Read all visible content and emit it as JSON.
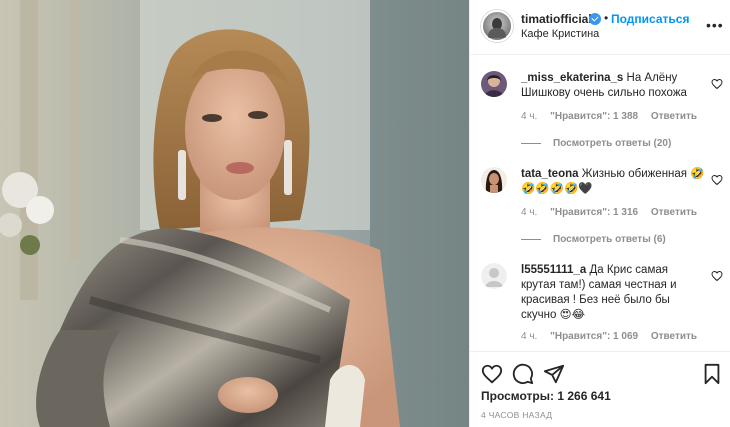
{
  "post": {
    "username": "timatiofficial",
    "follow_label": "Подписаться",
    "separator": "•",
    "location": "Кафе Кристина",
    "more_label": "•••"
  },
  "comments": [
    {
      "username": "_miss_ekaterina_s",
      "text": "На Алёну Шишкову очень сильно похожа",
      "time": "4 ч.",
      "likes": "\"Нравится\": 1 388",
      "reply": "Ответить",
      "view_replies": "Посмотреть ответы (20)"
    },
    {
      "username": "tata_teona",
      "text": "Жизнью обиженная 🤣🤣🤣🤣🤣🖤",
      "time": "4 ч.",
      "likes": "\"Нравится\": 1 316",
      "reply": "Ответить",
      "view_replies": "Посмотреть ответы (6)"
    },
    {
      "username": "l55551111_a",
      "text": "Да Крис самая крутая там!) самая честная и красивая ! Без неё было бы скучно 😍😂",
      "time": "4 ч.",
      "likes": "\"Нравится\": 1 069",
      "reply": "Ответить"
    }
  ],
  "footer": {
    "views_label": "Просмотры:",
    "views_count": "1 266 641",
    "posted": "4 ЧАСОВ НАЗАД"
  },
  "colors": {
    "accent": "#0095f6",
    "verified": "#3897f0",
    "secondary_text": "#8e8e8e",
    "text": "#262626"
  },
  "icons": [
    "verified-badge-icon",
    "more-options-icon",
    "heart-icon",
    "comment-icon",
    "share-icon",
    "bookmark-icon"
  ]
}
